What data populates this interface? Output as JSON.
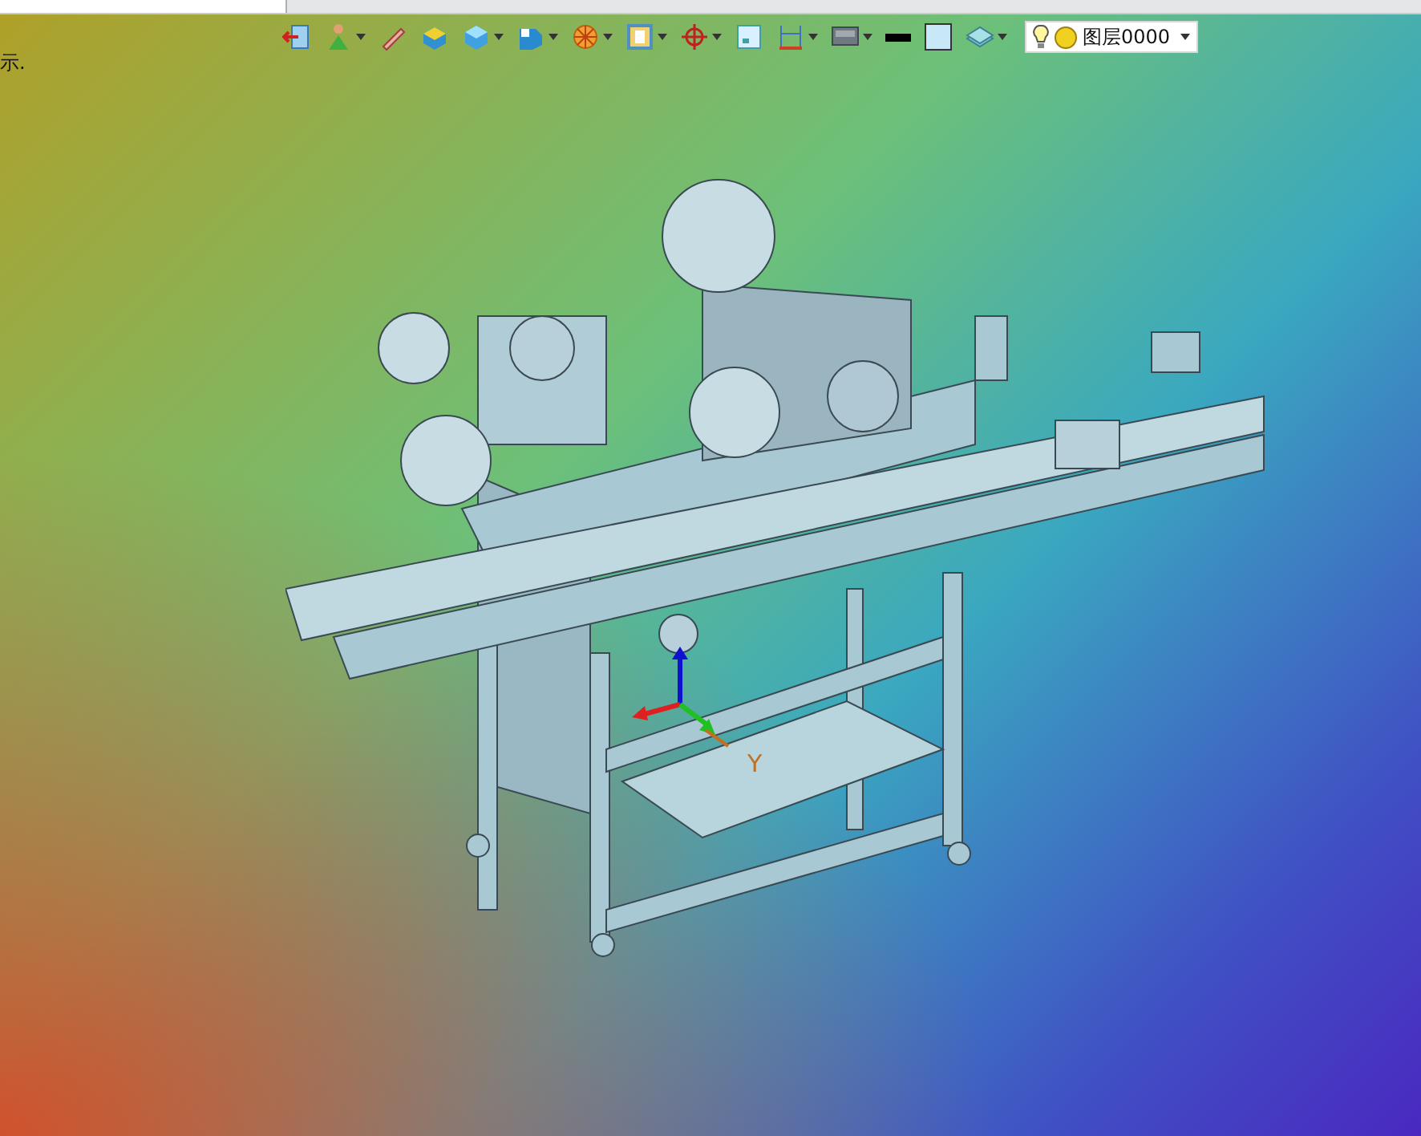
{
  "document_tab": {
    "selected": true
  },
  "hint": "示.",
  "toolbar": [
    {
      "kind": "exit",
      "menu": false
    },
    {
      "kind": "figure",
      "menu": true
    },
    {
      "kind": "pen",
      "menu": false
    },
    {
      "kind": "box",
      "menu": false
    },
    {
      "kind": "cube",
      "menu": true
    },
    {
      "kind": "solid",
      "menu": true
    },
    {
      "kind": "wheel",
      "menu": true
    },
    {
      "kind": "document",
      "menu": true
    },
    {
      "kind": "crosshair",
      "menu": true
    },
    {
      "kind": "frame",
      "menu": false
    },
    {
      "kind": "dimension",
      "menu": true
    },
    {
      "kind": "monitor",
      "menu": true
    },
    {
      "kind": "line",
      "menu": false
    },
    {
      "kind": "square",
      "menu": false
    },
    {
      "kind": "layers",
      "menu": true
    }
  ],
  "layer_select": {
    "value": "图层0000",
    "visible": true
  },
  "axis": {
    "label": "Y"
  }
}
